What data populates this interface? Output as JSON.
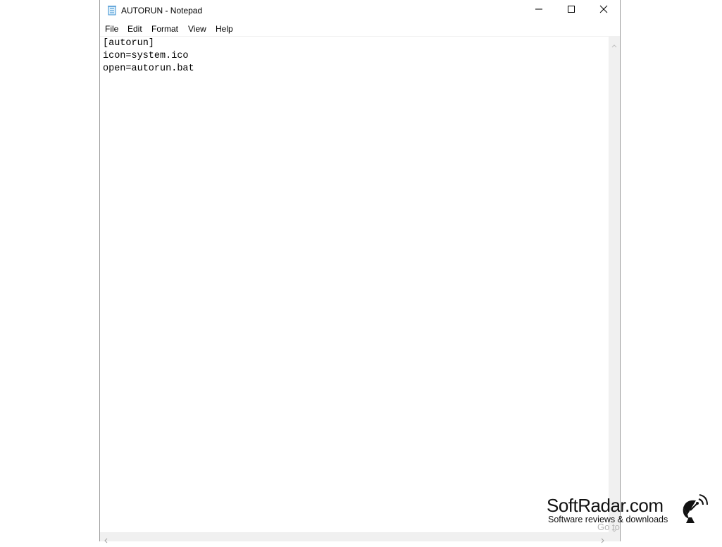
{
  "window": {
    "title": "AUTORUN - Notepad",
    "icon": "notepad-icon",
    "controls": [
      "minimize-icon",
      "maximize-icon",
      "close-icon"
    ]
  },
  "menu": {
    "file": "File",
    "edit": "Edit",
    "format": "Format",
    "view": "View",
    "help": "Help"
  },
  "editor": {
    "lines": [
      "[autorun]",
      "icon=system.ico",
      "open=autorun.bat"
    ]
  },
  "overlay": {
    "go_text": "Go to"
  },
  "watermark": {
    "title": "SoftRadar.com",
    "subtitle": "Software reviews & downloads",
    "icon": "satellite-dish-icon"
  }
}
